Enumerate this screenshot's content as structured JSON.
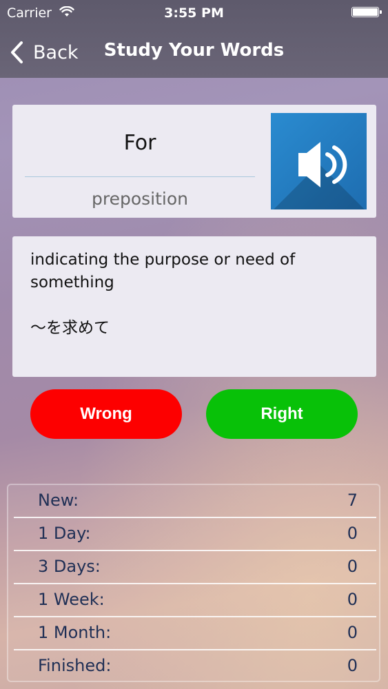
{
  "status_bar": {
    "carrier": "Carrier",
    "time": "3:55 PM"
  },
  "nav": {
    "back_label": "Back",
    "title": "Study Your Words"
  },
  "word": {
    "text": "For",
    "part_of_speech": "preposition"
  },
  "definition": {
    "english": "indicating the purpose or need of something",
    "japanese": "～を求めて"
  },
  "buttons": {
    "wrong": "Wrong",
    "right": "Right"
  },
  "stats": [
    {
      "label": "New:",
      "value": "7"
    },
    {
      "label": "1 Day:",
      "value": "0"
    },
    {
      "label": "3 Days:",
      "value": "0"
    },
    {
      "label": "1 Week:",
      "value": "0"
    },
    {
      "label": "1 Month:",
      "value": "0"
    },
    {
      "label": "Finished:",
      "value": "0"
    }
  ],
  "icons": {
    "wifi": "wifi-icon",
    "battery": "battery-icon",
    "back": "chevron-left-icon",
    "speaker": "speaker-icon"
  },
  "colors": {
    "wrong": "#fd0000",
    "right": "#08c108",
    "speaker": "#2a8bd0",
    "stats_text": "#1f2f55"
  }
}
